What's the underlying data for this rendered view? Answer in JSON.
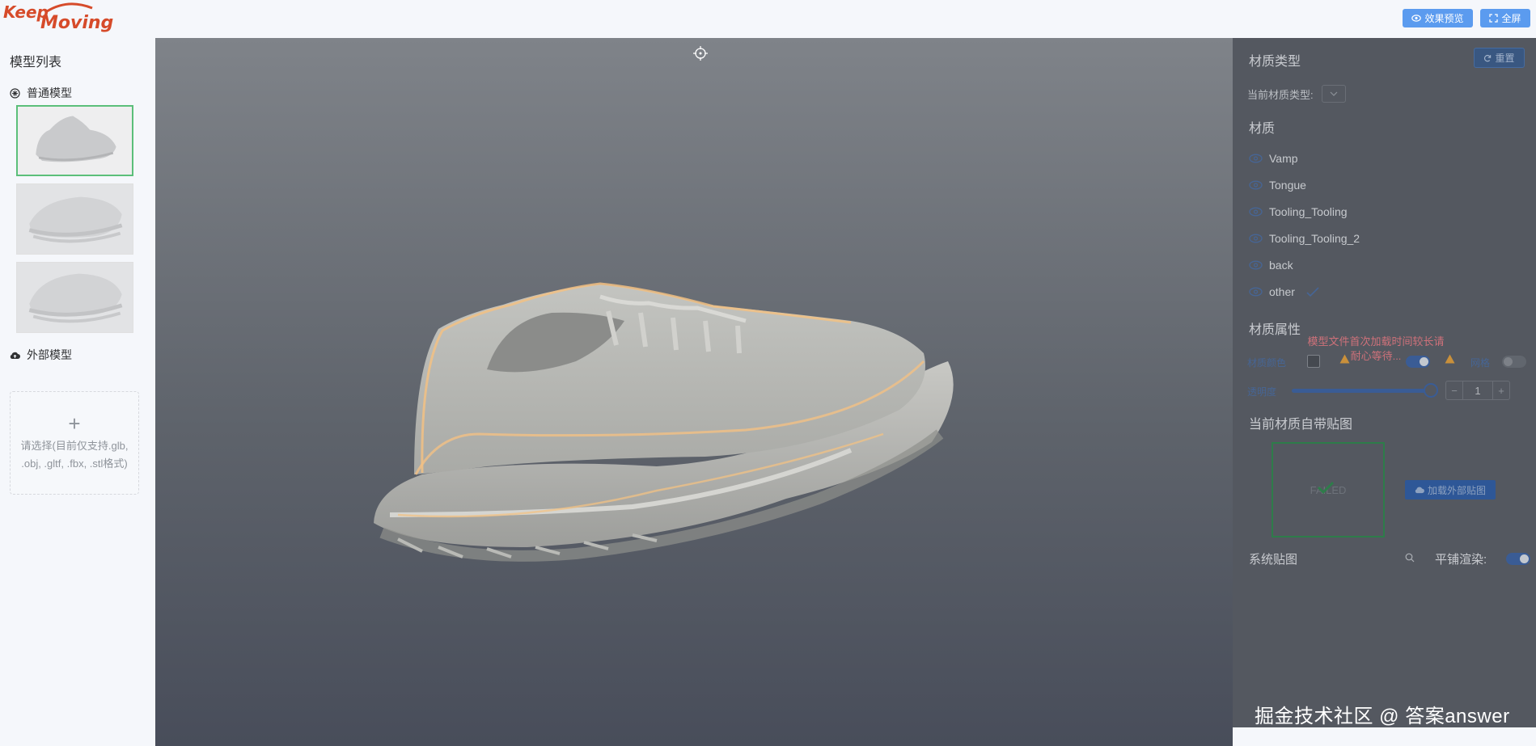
{
  "header": {
    "logo_line1": "Keep",
    "logo_line2": "Moving",
    "preview_button": "效果预览",
    "fullscreen_button": "全屏",
    "accent_color": "#5b9bef"
  },
  "left_panel": {
    "title": "模型列表",
    "common_models_label": "普通模型",
    "external_models_label": "外部模型",
    "upload_tip": "请选择(目前仅支持.glb, .obj, .gltf, .fbx, .stl格式)"
  },
  "viewport": {
    "icons": [
      "crosshair-icon"
    ]
  },
  "right_panel": {
    "material_type_title": "材质类型",
    "reset_button": "重置",
    "current_type_label": "当前材质类型:",
    "materials_title": "材质",
    "materials": [
      {
        "name": "Vamp",
        "selected": false
      },
      {
        "name": "Tongue",
        "selected": false
      },
      {
        "name": "Tooling_Tooling",
        "selected": false
      },
      {
        "name": "Tooling_Tooling_2",
        "selected": false
      },
      {
        "name": "back",
        "selected": false
      },
      {
        "name": "other",
        "selected": true
      }
    ],
    "properties_title": "材质属性",
    "loading_message": "模型文件首次加载时间较长请耐心等待...",
    "color_label": "材质颜色",
    "mesh_label": "网格",
    "opacity_label": "透明度",
    "opacity_value": "1",
    "texture_title": "当前材质自带贴图",
    "texture_status": "FAILED",
    "load_texture_button": "加载外部贴图",
    "system_texture_label": "系统贴图",
    "tile_render_label": "平铺渲染:",
    "tile_render_on": true,
    "status_color_warning": "#e6a23c",
    "status_color_error": "#ec7d86"
  },
  "watermark": "掘金技术社区 @ 答案answer"
}
